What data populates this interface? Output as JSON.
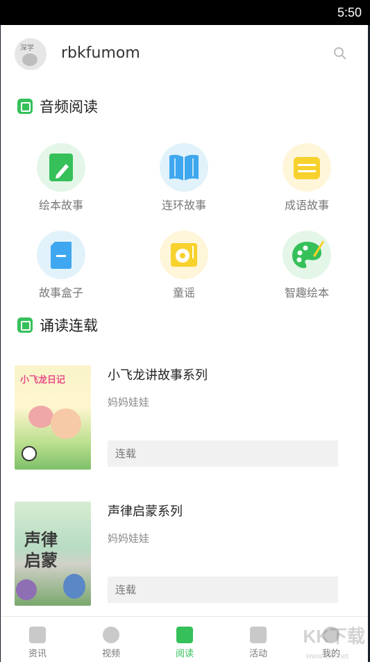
{
  "status_bar": {
    "time": "5:50"
  },
  "header": {
    "username": "rbkfumom",
    "avatar_text": "深学",
    "search_icon": "search-icon"
  },
  "audio_section": {
    "title": "音频阅读",
    "items": [
      {
        "label": "绘本故事",
        "icon": "picture-book-icon"
      },
      {
        "label": "连环故事",
        "icon": "open-book-icon"
      },
      {
        "label": "成语故事",
        "icon": "idiom-stack-icon"
      },
      {
        "label": "故事盒子",
        "icon": "story-box-icon"
      },
      {
        "label": "童谣",
        "icon": "record-player-icon"
      },
      {
        "label": "智趣绘本",
        "icon": "palette-icon"
      }
    ]
  },
  "serial_section": {
    "title": "诵读连载",
    "items": [
      {
        "title": "小飞龙讲故事系列",
        "author": "妈妈娃娃",
        "status": "连载",
        "cover_text": "小飞龙日记"
      },
      {
        "title": "声律启蒙系列",
        "author": "妈妈娃娃",
        "status": "连载",
        "cover_text": "声律启蒙"
      }
    ]
  },
  "tabbar": {
    "tabs": [
      {
        "label": "资讯",
        "icon": "news-icon"
      },
      {
        "label": "视频",
        "icon": "video-icon"
      },
      {
        "label": "阅读",
        "icon": "reading-icon",
        "active": true
      },
      {
        "label": "活动",
        "icon": "activity-icon"
      },
      {
        "label": "我的",
        "icon": "profile-icon"
      }
    ]
  },
  "watermark": {
    "text": "KK下载",
    "sub": "www.kkx.net"
  },
  "colors": {
    "accent": "#35c05a",
    "blue": "#3ea7ef",
    "yellow": "#f7d12c"
  }
}
